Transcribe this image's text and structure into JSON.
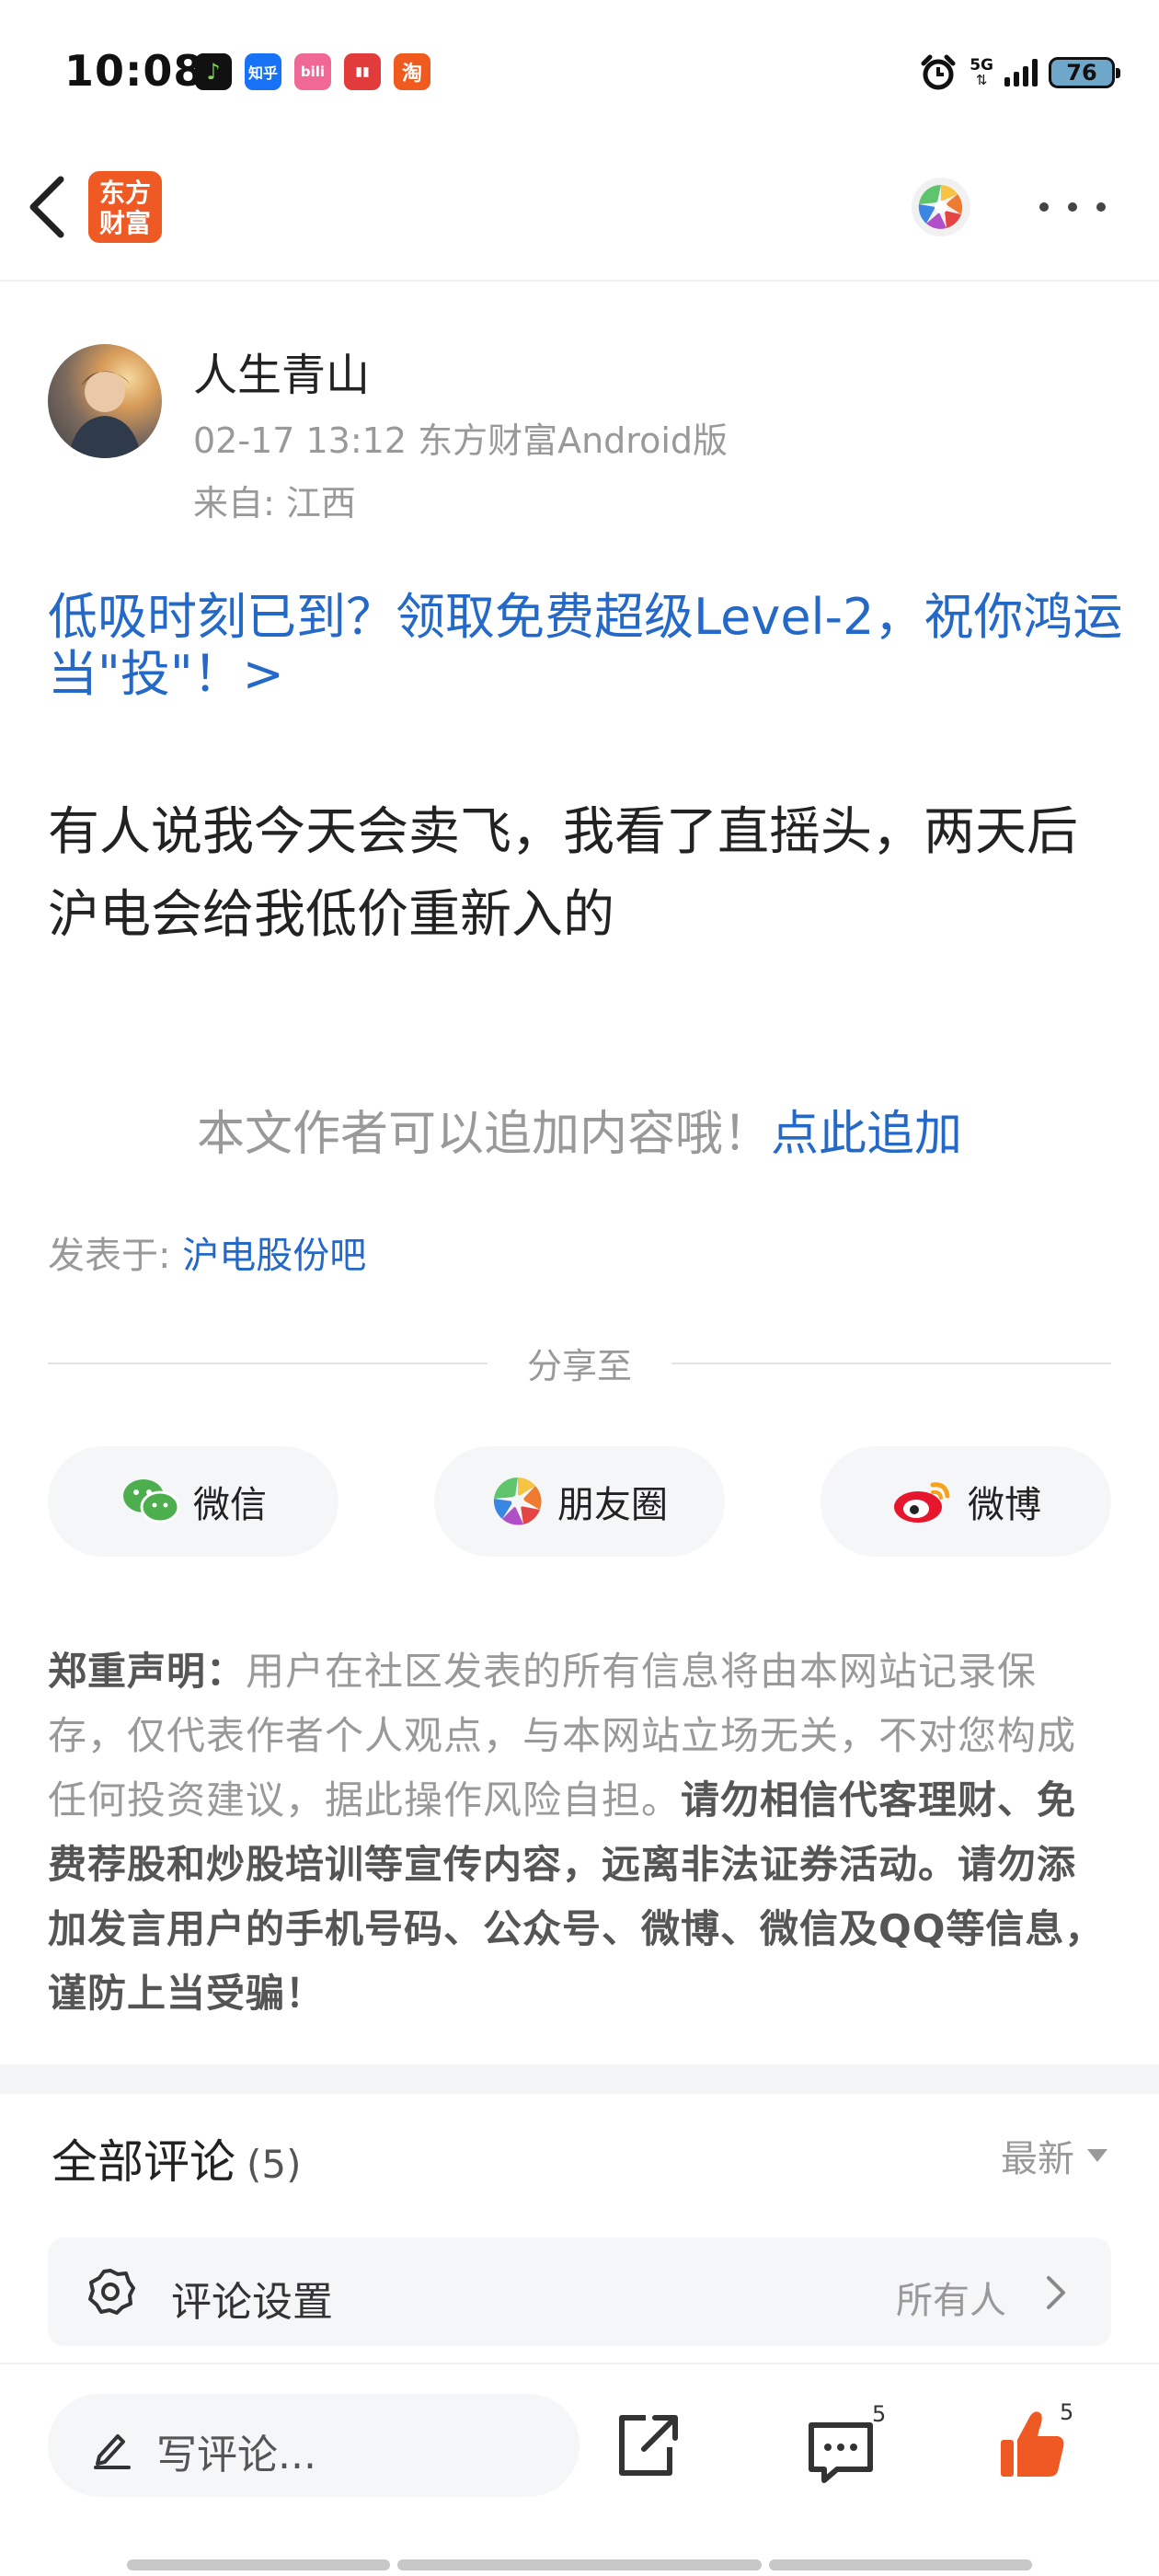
{
  "status_bar": {
    "time": "10:08",
    "notifications": [
      {
        "icon": "music-app-icon",
        "color": "#111111",
        "glyph": "♪"
      },
      {
        "icon": "zhihu-app-icon",
        "color": "#1772f6",
        "glyph": "知乎"
      },
      {
        "icon": "bilibili-app-icon",
        "color": "#f06996",
        "glyph": "bili"
      },
      {
        "icon": "chart-app-icon",
        "color": "#e23b3b",
        "glyph": "▮▮"
      },
      {
        "icon": "taobao-app-icon",
        "color": "#f05a1f",
        "glyph": "淘"
      }
    ],
    "network": "5G",
    "battery": "76"
  },
  "nav": {
    "logo_text": "东方财富",
    "logo_color": "#ef5a24"
  },
  "post": {
    "author": "人生青山",
    "meta": "02-17 13:12 东方财富Android版",
    "from": "来自: 江西",
    "promo": "低吸时刻已到？领取免费超级Level-2，祝你鸿运当\"投\"！>",
    "body": "有人说我今天会卖飞，我看了直摇头，两天后沪电会给我低价重新入的",
    "append_prompt": "本文作者可以追加内容哦！",
    "append_link": "点此追加",
    "posted_in_label": "发表于: ",
    "posted_in_link": "沪电股份吧"
  },
  "share": {
    "label": "分享至",
    "buttons": [
      {
        "label": "微信",
        "icon": "wechat-icon"
      },
      {
        "label": "朋友圈",
        "icon": "moments-icon"
      },
      {
        "label": "微博",
        "icon": "weibo-icon"
      }
    ]
  },
  "disclaimer": {
    "title": "郑重声明：",
    "part1": "用户在社区发表的所有信息将由本网站记录保存，仅代表作者个人观点，与本网站立场无关，不对您构成任何投资建议，据此操作风险自担。",
    "part2": "请勿相信代客理财、免费荐股和炒股培训等宣传内容，远离非法证券活动。请勿添加发言用户的手机号码、公众号、微博、微信及QQ等信息，谨防上当受骗！"
  },
  "comments": {
    "title": "全部评论",
    "count": "(5)",
    "sort": "最新",
    "settings_label": "评论设置",
    "settings_value": "所有人"
  },
  "bottom_bar": {
    "write_placeholder": "写评论...",
    "comment_count": "5",
    "like_count": "5",
    "accent": "#ef5a24",
    "link_color": "#2469c7"
  }
}
